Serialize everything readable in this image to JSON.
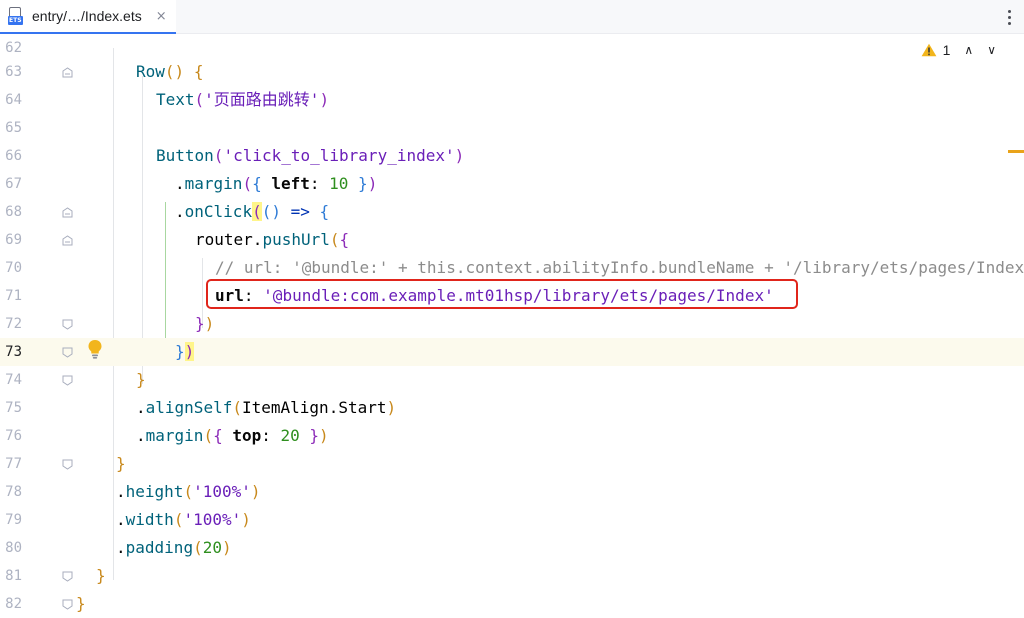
{
  "tab": {
    "file_badge": "ETS",
    "title": "entry/…/Index.ets",
    "close": "×"
  },
  "inspections": {
    "warning_count": "1",
    "prev": "∧",
    "next": "∨"
  },
  "lines": [
    {
      "n": "62"
    },
    {
      "n": "63"
    },
    {
      "n": "64"
    },
    {
      "n": "65"
    },
    {
      "n": "66"
    },
    {
      "n": "67"
    },
    {
      "n": "68"
    },
    {
      "n": "69"
    },
    {
      "n": "70"
    },
    {
      "n": "71"
    },
    {
      "n": "72"
    },
    {
      "n": "73"
    },
    {
      "n": "74"
    },
    {
      "n": "75"
    },
    {
      "n": "76"
    },
    {
      "n": "77"
    },
    {
      "n": "78"
    },
    {
      "n": "79"
    },
    {
      "n": "80"
    },
    {
      "n": "81"
    },
    {
      "n": "82"
    }
  ],
  "code": {
    "l63": {
      "fn": "Row",
      "open": "()",
      "sp": " ",
      "brace": "{"
    },
    "l64": {
      "fn": "Text",
      "po": "(",
      "str": "'页面路由跳转'",
      "pc": ")"
    },
    "l66": {
      "fn": "Button",
      "po": "(",
      "str": "'click_to_library_index'",
      "pc": ")"
    },
    "l67": {
      "dot": ".",
      "m": "margin",
      "po": "(",
      "bo": "{",
      "key": " left",
      "colon": ": ",
      "num": "10",
      "bc": " }",
      "pc": ")"
    },
    "l68": {
      "dot": ".",
      "m": "onClick",
      "po": "(",
      "args": "()",
      "arrow": " =>",
      "bo": " {"
    },
    "l69": {
      "obj": "router",
      "dot": ".",
      "m": "pushUrl",
      "po": "(",
      "bo": "{"
    },
    "l70": {
      "comment": "// url: '@bundle:' + this.context.abilityInfo.bundleName + '/library/ets/pages/Index'"
    },
    "l71": {
      "key": "url",
      "colon": ": ",
      "str": "'@bundle:com.example.mt01hsp/library/ets/pages/Index'"
    },
    "l72": {
      "bc": "}",
      "pc": ")"
    },
    "l73": {
      "bc": "}",
      "pc": ")"
    },
    "l74": {
      "bc": "}"
    },
    "l75": {
      "dot": ".",
      "m": "alignSelf",
      "po": "(",
      "cls": "ItemAlign",
      "dot2": ".",
      "prop": "Start",
      "pc": ")"
    },
    "l76": {
      "dot": ".",
      "m": "margin",
      "po": "(",
      "bo": "{",
      "key": " top",
      "colon": ": ",
      "num": "20",
      "bc": " }",
      "pc": ")"
    },
    "l77": {
      "bc": "}"
    },
    "l78": {
      "dot": ".",
      "m": "height",
      "po": "(",
      "str": "'100%'",
      "pc": ")"
    },
    "l79": {
      "dot": ".",
      "m": "width",
      "po": "(",
      "str": "'100%'",
      "pc": ")"
    },
    "l80": {
      "dot": ".",
      "m": "padding",
      "po": "(",
      "num": "20",
      "pc": ")"
    },
    "l81": {
      "bc": "}"
    },
    "l82": {
      "bc": "}"
    }
  },
  "colors": {
    "highlight_box": "#e0251b",
    "current_line": "#fcfaed",
    "tab_underline": "#3574f0"
  }
}
